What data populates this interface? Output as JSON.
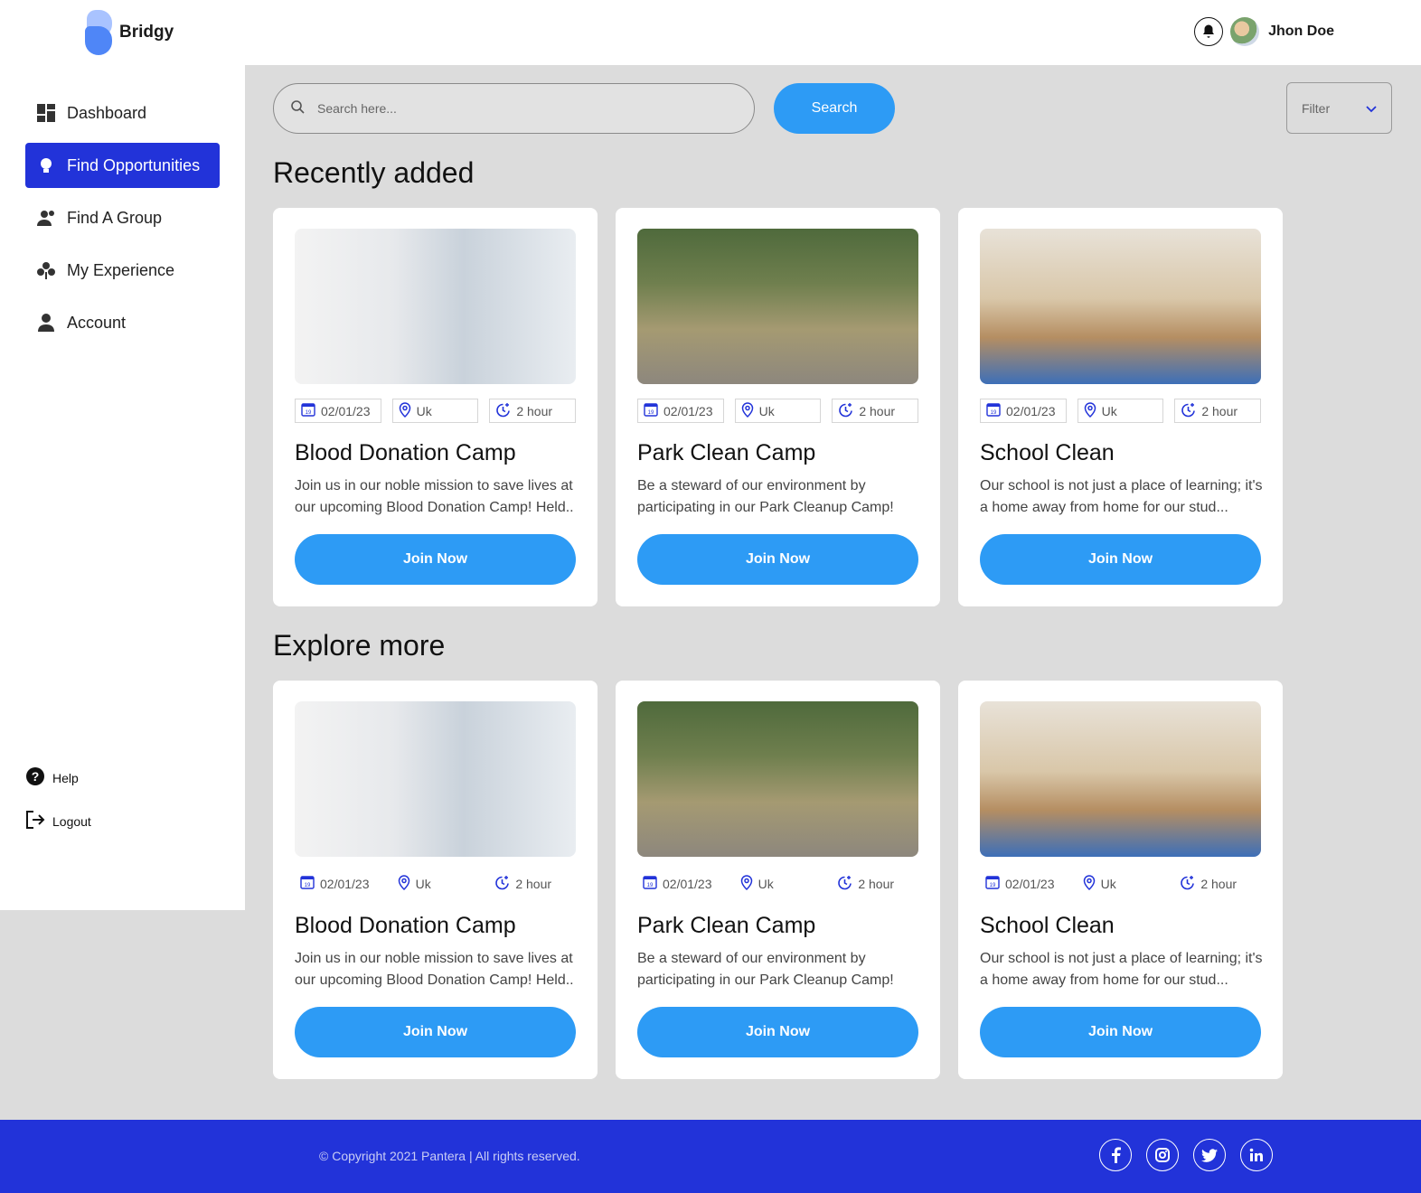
{
  "brand": {
    "name": "Bridgy"
  },
  "user": {
    "name": "Jhon Doe"
  },
  "sidebar": {
    "items": [
      {
        "label": "Dashboard",
        "icon": "dashboard-icon"
      },
      {
        "label": "Find Opportunities",
        "icon": "lightbulb-icon",
        "active": true
      },
      {
        "label": "Find A Group",
        "icon": "group-icon"
      },
      {
        "label": "My Experience",
        "icon": "experience-icon"
      },
      {
        "label": "Account",
        "icon": "user-icon"
      }
    ],
    "help_label": "Help",
    "logout_label": "Logout"
  },
  "search": {
    "placeholder": "Search here...",
    "button_label": "Search"
  },
  "filter": {
    "label": "Filter"
  },
  "sections": {
    "recent": {
      "title": "Recently added",
      "cards": [
        {
          "date": "02/01/23",
          "location": "Uk",
          "duration": "2 hour",
          "title": "Blood Donation Camp",
          "description": "Join us in our noble mission to save lives at our upcoming Blood Donation Camp! Held..",
          "button": "Join Now"
        },
        {
          "date": "02/01/23",
          "location": "Uk",
          "duration": "2 hour",
          "title": "Park Clean Camp",
          "description": "Be a steward of our environment by participating in our Park Cleanup Camp!",
          "button": "Join Now"
        },
        {
          "date": "02/01/23",
          "location": "Uk",
          "duration": "2 hour",
          "title": "School Clean",
          "description": "Our school is not just a place of learning; it's a home away from home for our stud...",
          "button": "Join Now"
        }
      ]
    },
    "explore": {
      "title": "Explore more",
      "cards": [
        {
          "date": "02/01/23",
          "location": "Uk",
          "duration": "2 hour",
          "title": "Blood Donation Camp",
          "description": "Join us in our noble mission to save lives at our upcoming Blood Donation Camp! Held..",
          "button": "Join Now"
        },
        {
          "date": "02/01/23",
          "location": "Uk",
          "duration": "2 hour",
          "title": "Park Clean Camp",
          "description": "Be a steward of our environment by participating in our Park Cleanup Camp!",
          "button": "Join Now"
        },
        {
          "date": "02/01/23",
          "location": "Uk",
          "duration": "2 hour",
          "title": "School Clean",
          "description": "Our school is not just a place of learning; it's a home away from home for our stud...",
          "button": "Join Now"
        }
      ]
    }
  },
  "footer": {
    "copyright": "© Copyright 2021 Pantera | All rights reserved.",
    "socials": [
      "facebook-icon",
      "instagram-icon",
      "twitter-icon",
      "linkedin-icon"
    ]
  },
  "colors": {
    "primary": "#2233d9",
    "accent": "#2d9bf5",
    "background": "#dcdcdc"
  }
}
